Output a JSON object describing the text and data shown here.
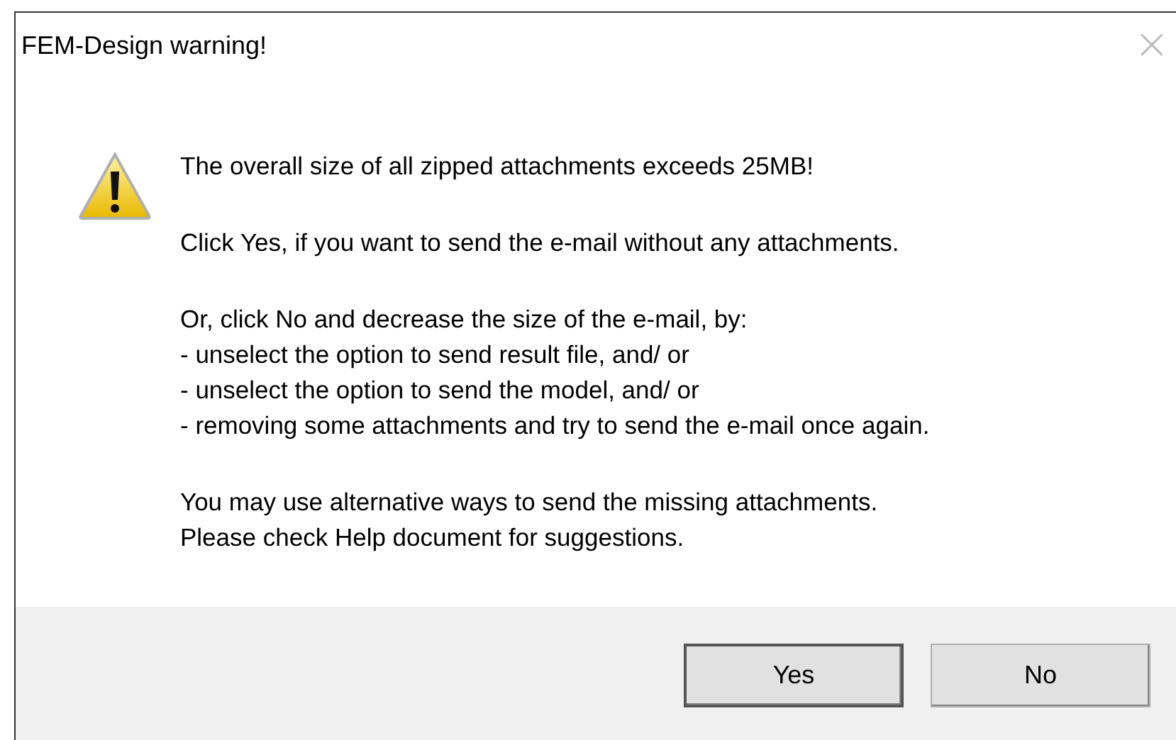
{
  "window": {
    "title": "FEM-Design warning!",
    "close": "×"
  },
  "message": {
    "paragraphs": [
      {
        "lines": [
          "The overall size of all zipped attachments exceeds 25MB!"
        ]
      },
      {
        "lines": [
          "Click Yes, if you want to send the e-mail without any attachments."
        ]
      },
      {
        "lines": [
          "Or, click No and decrease the size of the e-mail, by:",
          "- unselect the option to send result file, and/ or",
          "- unselect the option to send the model, and/ or",
          "- removing some attachments and try to send the e-mail once again."
        ]
      },
      {
        "lines": [
          "You may use alternative ways to send the missing attachments.",
          "Please check Help document for suggestions."
        ]
      }
    ]
  },
  "buttons": [
    {
      "label": "Yes",
      "default": true
    },
    {
      "label": "No",
      "default": false
    }
  ]
}
